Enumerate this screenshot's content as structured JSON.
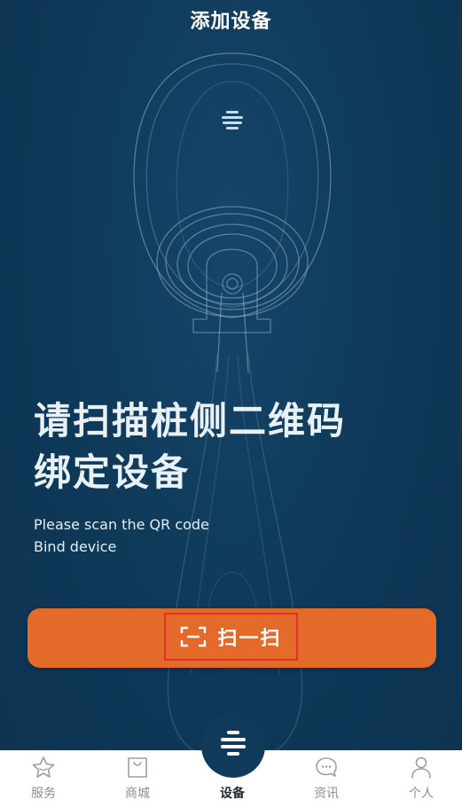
{
  "header": {
    "title": "添加设备"
  },
  "main": {
    "headline_line1": "请扫描桩侧二维码",
    "headline_line2": "绑定设备",
    "subtitle_line1": "Please scan the QR code",
    "subtitle_line2": "Bind device"
  },
  "scan_button": {
    "label": "扫一扫",
    "icon": "scan-qr-icon"
  },
  "tabbar": {
    "items": [
      {
        "label": "服务",
        "icon": "star-icon",
        "active": false
      },
      {
        "label": "商城",
        "icon": "shopping-bag-icon",
        "active": false
      },
      {
        "label": "设备",
        "icon": "charger-logo-icon",
        "active": true
      },
      {
        "label": "资讯",
        "icon": "chat-bubble-icon",
        "active": false
      },
      {
        "label": "个人",
        "icon": "user-icon",
        "active": false
      }
    ]
  },
  "colors": {
    "background": "#0f3a5a",
    "accent": "#e46a2a",
    "highlight_border": "#e1332b",
    "tab_inactive": "#8a8f94"
  }
}
